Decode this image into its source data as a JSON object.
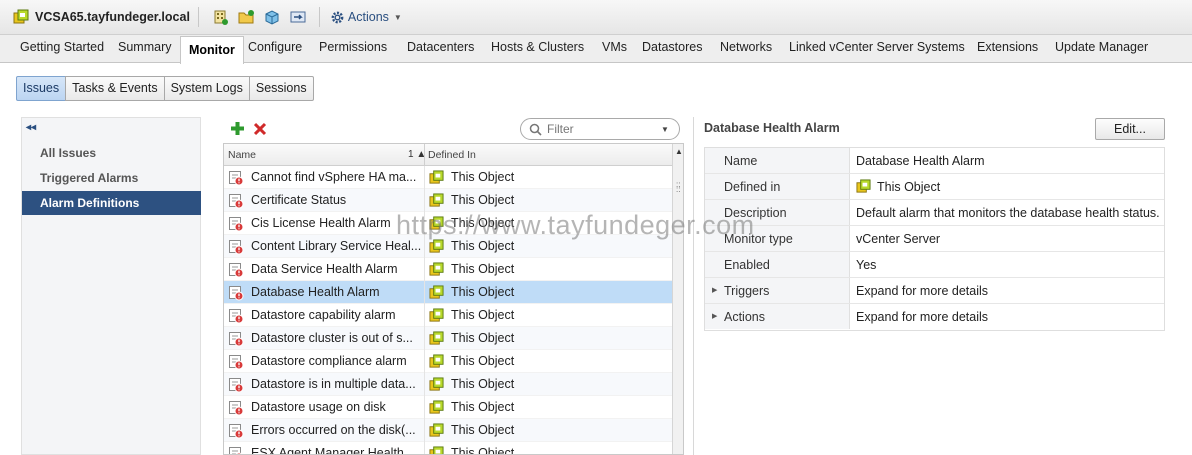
{
  "title_bar": {
    "title": "VCSA65.tayfundeger.local",
    "actions_label": "Actions",
    "icons": [
      "vcenter-icon",
      "new-datacenter-icon",
      "new-folder-icon",
      "deploy-ovf-icon",
      "migrate-icon",
      "gear-icon"
    ]
  },
  "main_tabs": [
    {
      "label": "Getting Started"
    },
    {
      "label": "Summary"
    },
    {
      "label": "Monitor",
      "active": true
    },
    {
      "label": "Configure"
    },
    {
      "label": "Permissions"
    },
    {
      "label": "Datacenters"
    },
    {
      "label": "Hosts & Clusters"
    },
    {
      "label": "VMs"
    },
    {
      "label": "Datastores"
    },
    {
      "label": "Networks"
    },
    {
      "label": "Linked vCenter Server Systems"
    },
    {
      "label": "Extensions"
    },
    {
      "label": "Update Manager"
    }
  ],
  "sub_tabs": [
    {
      "label": "Issues",
      "active": true
    },
    {
      "label": "Tasks & Events"
    },
    {
      "label": "System Logs"
    },
    {
      "label": "Sessions"
    }
  ],
  "left_nav": {
    "items": [
      {
        "label": "All Issues"
      },
      {
        "label": "Triggered Alarms"
      },
      {
        "label": "Alarm Definitions",
        "active": true
      }
    ]
  },
  "filter": {
    "placeholder": "Filter"
  },
  "grid": {
    "columns": {
      "name": "Name",
      "sort_indicator": "1 ▲",
      "defined_in": "Defined In"
    },
    "rows": [
      {
        "name": "Cannot find vSphere HA ma...",
        "defined_in": "This Object"
      },
      {
        "name": "Certificate Status",
        "defined_in": "This Object"
      },
      {
        "name": "Cis License Health Alarm",
        "defined_in": "This Object"
      },
      {
        "name": "Content Library Service Heal...",
        "defined_in": "This Object"
      },
      {
        "name": "Data Service Health Alarm",
        "defined_in": "This Object"
      },
      {
        "name": "Database Health Alarm",
        "defined_in": "This Object",
        "selected": true
      },
      {
        "name": "Datastore capability alarm",
        "defined_in": "This Object"
      },
      {
        "name": "Datastore cluster is out of s...",
        "defined_in": "This Object"
      },
      {
        "name": "Datastore compliance alarm",
        "defined_in": "This Object"
      },
      {
        "name": "Datastore is in multiple data...",
        "defined_in": "This Object"
      },
      {
        "name": "Datastore usage on disk",
        "defined_in": "This Object"
      },
      {
        "name": "Errors occurred on the disk(...",
        "defined_in": "This Object"
      },
      {
        "name": "ESX Agent Manager Health",
        "defined_in": "This Object"
      }
    ]
  },
  "details": {
    "title": "Database Health Alarm",
    "edit_label": "Edit...",
    "properties": [
      {
        "key": "Name",
        "value": "Database Health Alarm"
      },
      {
        "key": "Defined in",
        "value": "This Object",
        "icon": "vcenter-object-icon"
      },
      {
        "key": "Description",
        "value": "Default alarm that monitors the database health status."
      },
      {
        "key": "Monitor type",
        "value": "vCenter Server"
      },
      {
        "key": "Enabled",
        "value": "Yes"
      },
      {
        "key": "Triggers",
        "value": "Expand for more details",
        "expandable": true
      },
      {
        "key": "Actions",
        "value": "Expand for more details",
        "expandable": true
      }
    ]
  },
  "watermark": "https://www.tayfundeger.com",
  "colors": {
    "nav_active_bg": "#2d5181",
    "row_selected_bg": "#bfdcf7",
    "subtab_active_bg": "#c9ddf5",
    "add_icon": "#2e9a2e",
    "delete_icon": "#d02a2a"
  }
}
